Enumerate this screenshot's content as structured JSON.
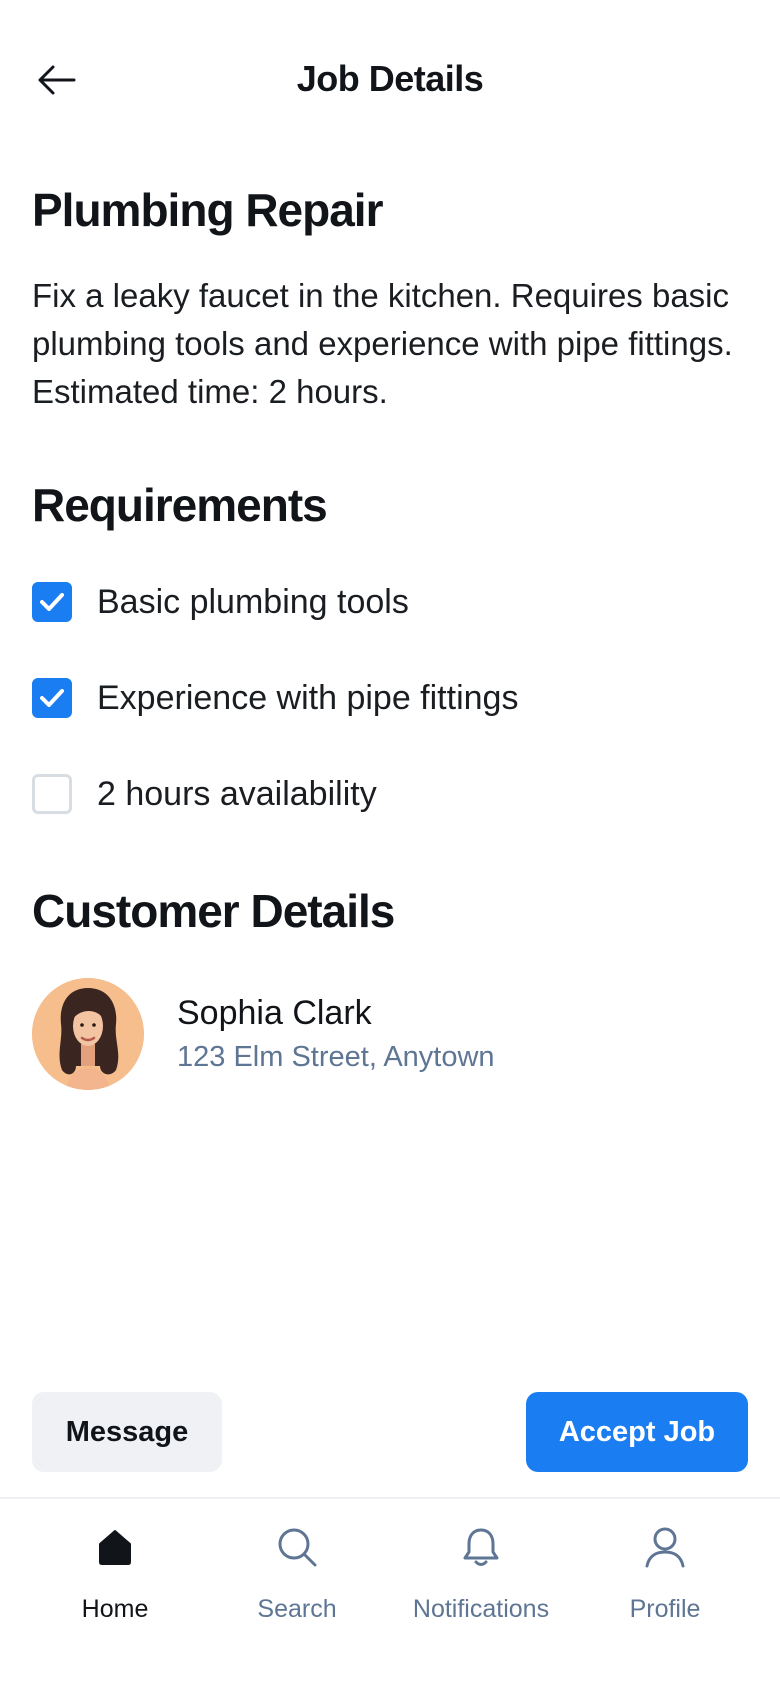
{
  "header": {
    "title": "Job Details",
    "back_icon": "arrow-left-icon"
  },
  "job": {
    "title": "Plumbing Repair",
    "description": "Fix a leaky faucet in the kitchen. Requires basic plumbing tools and experience with pipe fittings. Estimated time: 2 hours."
  },
  "requirements": {
    "title": "Requirements",
    "items": [
      {
        "label": "Basic plumbing tools",
        "checked": true
      },
      {
        "label": "Experience with pipe fittings",
        "checked": true
      },
      {
        "label": "2 hours availability",
        "checked": false
      }
    ]
  },
  "customer": {
    "title": "Customer Details",
    "name": "Sophia Clark",
    "address": "123 Elm Street, Anytown"
  },
  "actions": {
    "message_label": "Message",
    "accept_label": "Accept Job"
  },
  "nav": {
    "items": [
      {
        "label": "Home",
        "icon": "home-icon",
        "active": true
      },
      {
        "label": "Search",
        "icon": "search-icon",
        "active": false
      },
      {
        "label": "Notifications",
        "icon": "bell-icon",
        "active": false
      },
      {
        "label": "Profile",
        "icon": "user-icon",
        "active": false
      }
    ]
  },
  "colors": {
    "accent": "#1a7df2",
    "muted": "#5e7594",
    "avatar_bg": "#f6bd8d"
  }
}
